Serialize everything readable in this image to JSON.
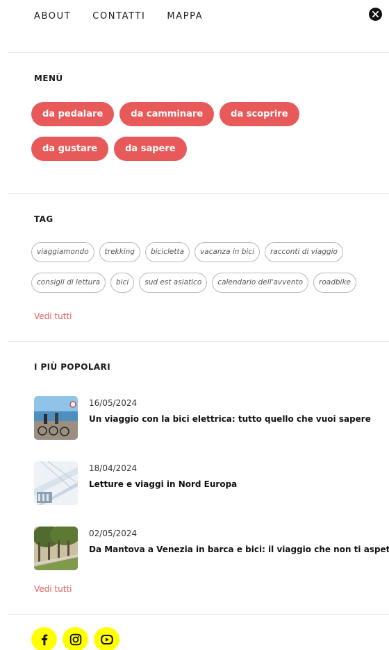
{
  "nav": {
    "links": [
      "ABOUT",
      "CONTATTI",
      "MAPPA"
    ],
    "close_icon": "close-icon"
  },
  "menu": {
    "title": "MENÙ",
    "items": [
      "da pedalare",
      "da camminare",
      "da scoprire",
      "da gustare",
      "da sapere"
    ]
  },
  "tags": {
    "title": "TAG",
    "items": [
      "viaggiamondo",
      "trekking",
      "bicicletta",
      "vacanza in bici",
      "racconti di viaggio",
      "consigli di lettura",
      "bici",
      "sud est asiatico",
      "calendario dell'avvento",
      "roadbike"
    ],
    "see_all": "Vedi tutti"
  },
  "popular": {
    "title": "I PIÙ POPOLARI",
    "posts": [
      {
        "date": "16/05/2024",
        "title": "Un viaggio con la bici elettrica: tutto quello che vuoi sapere"
      },
      {
        "date": "18/04/2024",
        "title": "Letture e viaggi in Nord Europa"
      },
      {
        "date": "02/05/2024",
        "title": "Da Mantova a Venezia in barca e bici: il viaggio che non ti aspetti"
      }
    ],
    "see_all": "Vedi tutti"
  },
  "social": {
    "icons": [
      "facebook-icon",
      "instagram-icon",
      "youtube-icon"
    ],
    "accent": "#ffff00"
  },
  "colors": {
    "accent": "#e85a5a"
  }
}
